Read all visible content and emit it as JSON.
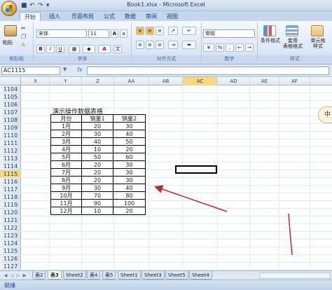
{
  "window": {
    "title": "Book1.xlsx - Microsoft Excel"
  },
  "ribbon": {
    "tabs": [
      "开始",
      "插入",
      "页面布局",
      "公式",
      "数据",
      "审阅",
      "视图"
    ],
    "active_tab": "开始",
    "clipboard": {
      "paste_label": "粘贴",
      "group_label": "剪贴板"
    },
    "font": {
      "name": "宋体",
      "size": "11",
      "group_label": "字体",
      "font_color": "#c00000",
      "fill_color": "#ffff00"
    },
    "alignment": {
      "group_label": "对齐方式"
    },
    "number": {
      "format": "常规",
      "percent": "%",
      "comma": ",",
      "group_label": "数字"
    },
    "styles": {
      "conditional": "条件格式",
      "table_format": "套用\n表格格式",
      "cell_styles": "单元格\n样式",
      "group_label": "样式"
    }
  },
  "formula_bar": {
    "name_box": "AC1115",
    "fx": "fx",
    "value": ""
  },
  "columns": [
    "X",
    "Y",
    "Z",
    "AA",
    "AB",
    "AC",
    "AD",
    "AE",
    "AF"
  ],
  "selected_column": "AC",
  "rows": [
    "1104",
    "1105",
    "1106",
    "1107",
    "1108",
    "1109",
    "1110",
    "1111",
    "1112",
    "1113",
    "1114",
    "1115",
    "1116",
    "1117",
    "1118",
    "1119",
    "1120",
    "1121",
    "1122",
    "1123",
    "1124",
    "1125",
    "1126",
    "1127"
  ],
  "selected_row": "1115",
  "sheet_table": {
    "title": "演示操作数据表格",
    "headers": [
      "月份",
      "销量1",
      "销量2"
    ],
    "rows": [
      [
        "1月",
        "20",
        "30"
      ],
      [
        "2月",
        "30",
        "40"
      ],
      [
        "3月",
        "40",
        "50"
      ],
      [
        "4月",
        "10",
        "20"
      ],
      [
        "5月",
        "50",
        "60"
      ],
      [
        "6月",
        "20",
        "30"
      ],
      [
        "7月",
        "20",
        "30"
      ],
      [
        "8月",
        "20",
        "30"
      ],
      [
        "9月",
        "30",
        "40"
      ],
      [
        "10月",
        "70",
        "80"
      ],
      [
        "11月",
        "90",
        "100"
      ],
      [
        "12月",
        "10",
        "20"
      ]
    ]
  },
  "annotation": {
    "arrow_color": "#c0272d"
  },
  "side_pill": "中",
  "sheet_tabs": [
    "表2",
    "表3",
    "Sheet2",
    "表4",
    "表5",
    "Sheet1",
    "Sheet3",
    "Sheet5",
    "Sheet4"
  ],
  "active_sheet": "表3",
  "status": {
    "text": "就绪"
  }
}
